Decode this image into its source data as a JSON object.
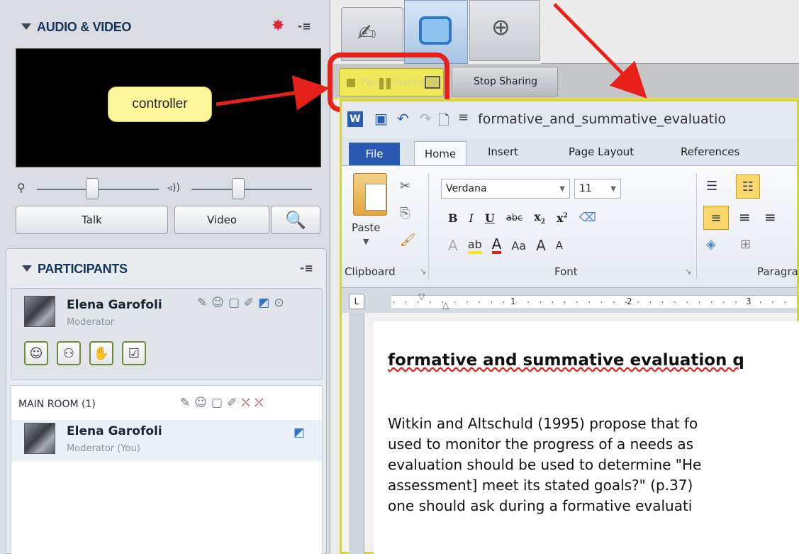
{
  "left_panel": {
    "audio_video": {
      "title": "AUDIO & VIDEO",
      "talk_label": "Talk",
      "video_label": "Video"
    },
    "callout_label": "controller",
    "participants": {
      "title": "PARTICIPANTS",
      "current_user": {
        "name": "Elena Garofoli",
        "role": "Moderator"
      },
      "main_room_label": "MAIN ROOM (1)",
      "room_list": [
        {
          "name": "Elena Garofoli",
          "role": "Moderator (You)"
        }
      ]
    }
  },
  "app_share": {
    "pause_share_label": "Pause Sharing",
    "stop_sharing_label": "Stop Sharing"
  },
  "word": {
    "doc_title": "formative_and_summative_evaluatio",
    "ribbon_tabs": [
      "File",
      "Home",
      "Insert",
      "Page Layout",
      "References"
    ],
    "font_name": "Verdana",
    "font_size": "11",
    "paste_label": "Paste",
    "groups": {
      "clipboard": "Clipboard",
      "font": "Font",
      "paragraph": "Paragra"
    },
    "ruler_marks": [
      "1",
      "2",
      "3"
    ],
    "document": {
      "heading": "formative and summative evaluation q",
      "lines": [
        "Witkin and Altschuld (1995) propose that fo",
        "used to monitor the progress of a needs as",
        "evaluation should be used to determine \"He",
        "assessment] meet its stated goals?\" (p.37)",
        "one should ask during a formative evaluati"
      ]
    }
  },
  "colors": {
    "highlight": "#efe95a",
    "annotation_red": "#e8201a",
    "word_blue": "#2a5bb3"
  }
}
